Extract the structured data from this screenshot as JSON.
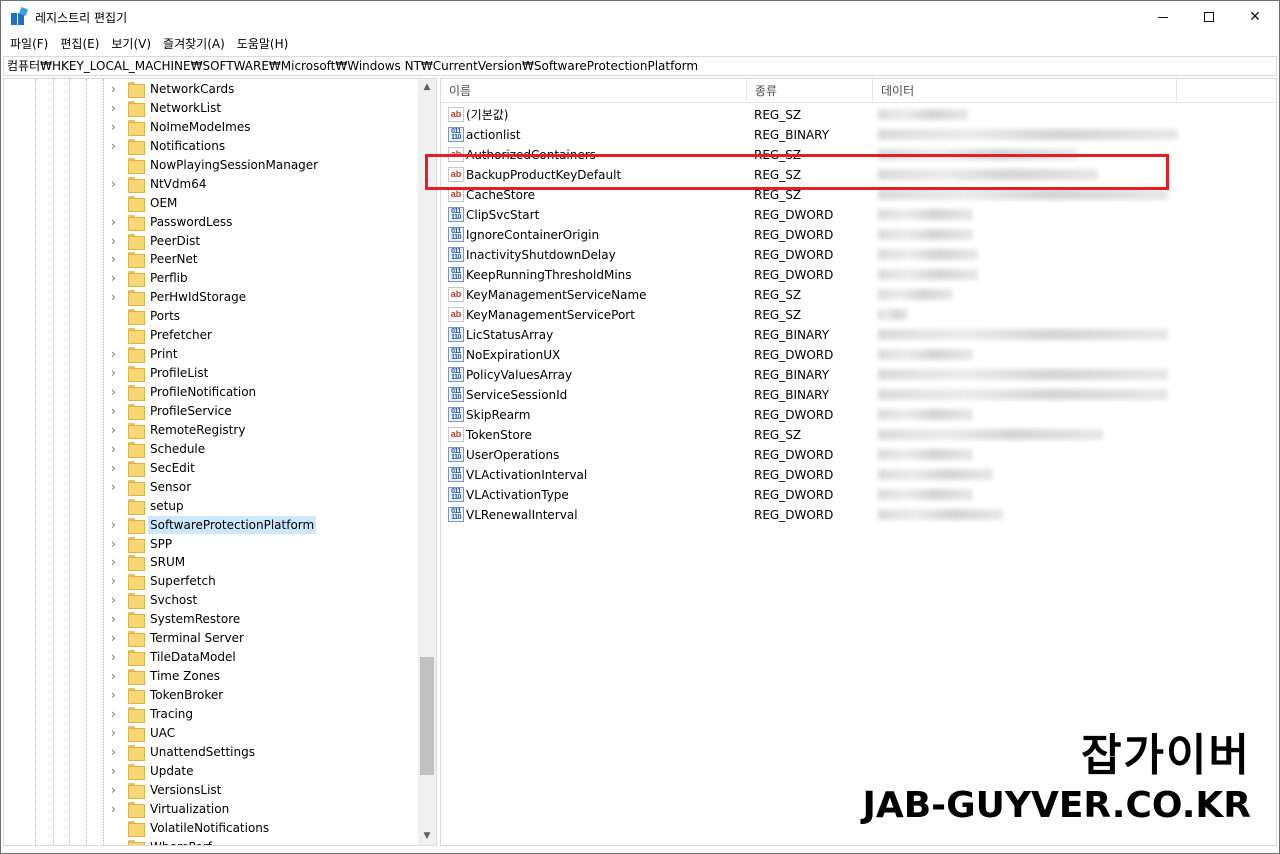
{
  "window": {
    "title": "레지스트리 편집기",
    "minimize_label": "—",
    "maximize_label": "☐",
    "close_label": "✕"
  },
  "menu": [
    "파일(F)",
    "편집(E)",
    "보기(V)",
    "즐겨찾기(A)",
    "도움말(H)"
  ],
  "address": "컴퓨터₩HKEY_LOCAL_MACHINE₩SOFTWARE₩Microsoft₩Windows NT₩CurrentVersion₩SoftwareProtectionPlatform",
  "tree": {
    "items": [
      "NetworkCards",
      "NetworkList",
      "NoImeModeImes",
      "Notifications",
      "NowPlayingSessionManager",
      "NtVdm64",
      "OEM",
      "PasswordLess",
      "PeerDist",
      "PeerNet",
      "Perflib",
      "PerHwIdStorage",
      "Ports",
      "Prefetcher",
      "Print",
      "ProfileList",
      "ProfileNotification",
      "ProfileService",
      "RemoteRegistry",
      "Schedule",
      "SecEdit",
      "Sensor",
      "setup",
      "SoftwareProtectionPlatform",
      "SPP",
      "SRUM",
      "Superfetch",
      "Svchost",
      "SystemRestore",
      "Terminal Server",
      "TileDataModel",
      "Time Zones",
      "TokenBroker",
      "Tracing",
      "UAC",
      "UnattendSettings",
      "Update",
      "VersionsList",
      "Virtualization",
      "VolatileNotifications",
      "WbemPerf"
    ],
    "selected": "SoftwareProtectionPlatform",
    "no_expander": [
      "NowPlayingSessionManager",
      "OEM",
      "Ports",
      "Prefetcher",
      "setup",
      "VolatileNotifications",
      "WbemPerf"
    ]
  },
  "columns": {
    "name": "이름",
    "type": "종류",
    "data": "데이터"
  },
  "values": [
    {
      "name": "(기본값)",
      "type": "REG_SZ",
      "icon": "string-value-icon"
    },
    {
      "name": "actionlist",
      "type": "REG_BINARY",
      "icon": "binary-value-icon"
    },
    {
      "name": "AuthorizedContainers",
      "type": "REG_SZ",
      "icon": "string-value-icon"
    },
    {
      "name": "BackupProductKeyDefault",
      "type": "REG_SZ",
      "icon": "string-value-icon"
    },
    {
      "name": "CacheStore",
      "type": "REG_SZ",
      "icon": "string-value-icon"
    },
    {
      "name": "ClipSvcStart",
      "type": "REG_DWORD",
      "icon": "binary-value-icon"
    },
    {
      "name": "IgnoreContainerOrigin",
      "type": "REG_DWORD",
      "icon": "binary-value-icon"
    },
    {
      "name": "InactivityShutdownDelay",
      "type": "REG_DWORD",
      "icon": "binary-value-icon"
    },
    {
      "name": "KeepRunningThresholdMins",
      "type": "REG_DWORD",
      "icon": "binary-value-icon"
    },
    {
      "name": "KeyManagementServiceName",
      "type": "REG_SZ",
      "icon": "string-value-icon"
    },
    {
      "name": "KeyManagementServicePort",
      "type": "REG_SZ",
      "icon": "string-value-icon"
    },
    {
      "name": "LicStatusArray",
      "type": "REG_BINARY",
      "icon": "binary-value-icon"
    },
    {
      "name": "NoExpirationUX",
      "type": "REG_DWORD",
      "icon": "binary-value-icon"
    },
    {
      "name": "PolicyValuesArray",
      "type": "REG_BINARY",
      "icon": "binary-value-icon"
    },
    {
      "name": "ServiceSessionId",
      "type": "REG_BINARY",
      "icon": "binary-value-icon"
    },
    {
      "name": "SkipRearm",
      "type": "REG_DWORD",
      "icon": "binary-value-icon"
    },
    {
      "name": "TokenStore",
      "type": "REG_SZ",
      "icon": "string-value-icon"
    },
    {
      "name": "UserOperations",
      "type": "REG_DWORD",
      "icon": "binary-value-icon"
    },
    {
      "name": "VLActivationInterval",
      "type": "REG_DWORD",
      "icon": "binary-value-icon"
    },
    {
      "name": "VLActivationType",
      "type": "REG_DWORD",
      "icon": "binary-value-icon"
    },
    {
      "name": "VLRenewalInterval",
      "type": "REG_DWORD",
      "icon": "binary-value-icon"
    }
  ],
  "highlighted_value": "BackupProductKeyDefault",
  "icon_glyphs": {
    "string": "ab",
    "binary": "011 110"
  },
  "colors": {
    "selection": "#cce8ff",
    "highlight_box": "#e31e24",
    "folder": "#f7d774"
  },
  "watermark": {
    "korean": "잡가이버",
    "latin": "JAB-GUYVER.CO.KR"
  }
}
